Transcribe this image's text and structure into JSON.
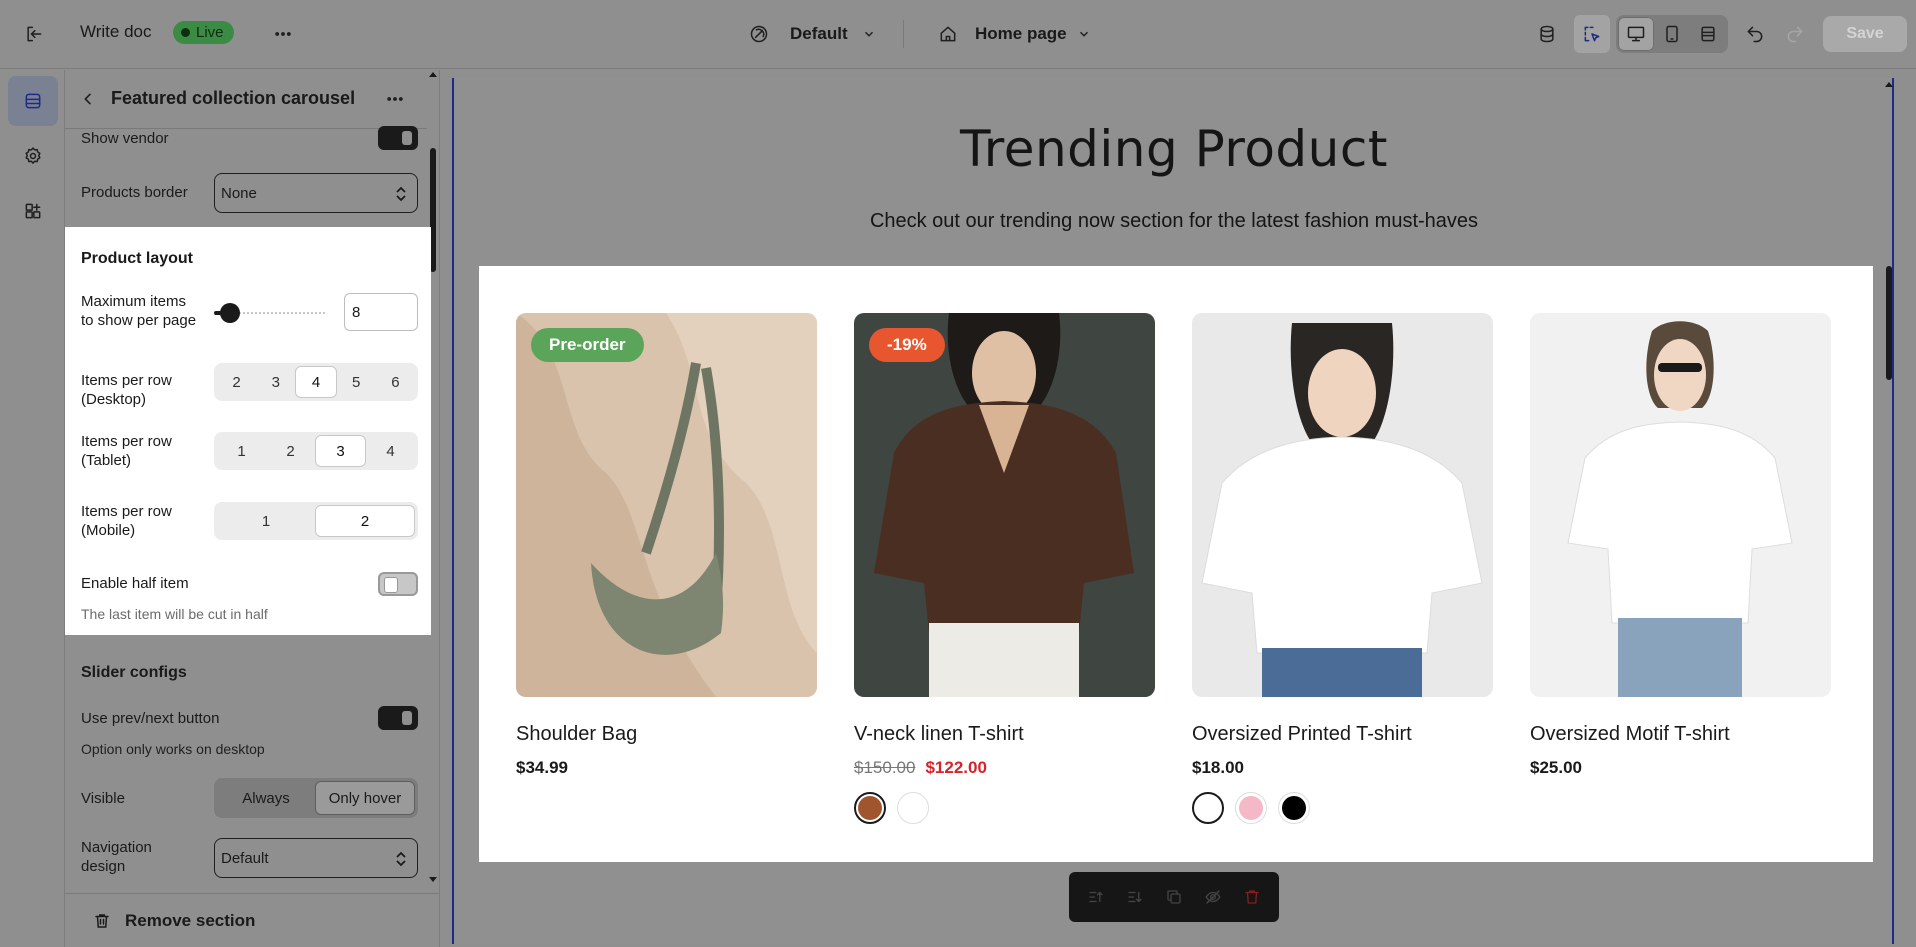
{
  "topbar": {
    "doc_title": "Write doc",
    "status": "Live",
    "theme_label": "Default",
    "page_label": "Home page",
    "save_label": "Save"
  },
  "panel": {
    "title": "Featured collection carousel",
    "show_vendor_label": "Show vendor",
    "products_border_label": "Products border",
    "products_border_value": "None",
    "product_layout_title": "Product layout",
    "max_items_label_1": "Maximum items",
    "max_items_label_2": "to show per page",
    "max_items_value": "8",
    "max_items_slider_fraction": 0.14,
    "desktop_label_1": "Items per row",
    "desktop_label_2": "(Desktop)",
    "desktop_options": [
      "2",
      "3",
      "4",
      "5",
      "6"
    ],
    "desktop_selected": "4",
    "tablet_label_1": "Items per row",
    "tablet_label_2": "(Tablet)",
    "tablet_options": [
      "1",
      "2",
      "3",
      "4"
    ],
    "tablet_selected": "3",
    "mobile_label_1": "Items per row",
    "mobile_label_2": "(Mobile)",
    "mobile_options": [
      "1",
      "2"
    ],
    "mobile_selected": "2",
    "half_item_label": "Enable half item",
    "half_item_hint": "The last item will be cut in half",
    "slider_configs_title": "Slider configs",
    "prev_next_label": "Use prev/next button",
    "prev_next_hint": "Option only works on desktop",
    "visible_label": "Visible",
    "visible_options": [
      "Always",
      "Only hover"
    ],
    "visible_selected": "Only hover",
    "nav_design_label_1": "Navigation",
    "nav_design_label_2": "design",
    "nav_design_value": "Default",
    "remove_label": "Remove section"
  },
  "canvas": {
    "heading": "Trending Product",
    "subheading": "Check out our trending now section for the latest fashion must-haves",
    "products": [
      {
        "name": "Shoulder Bag",
        "price": "$34.99",
        "badge": "Pre-order",
        "badge_color": "#5aa55a"
      },
      {
        "name": "V-neck linen T-shirt",
        "old_price": "$150.00",
        "price": "$122.00",
        "badge": "-19%",
        "badge_color": "#e8562f",
        "swatches": [
          "#a0552f",
          "#ffffff"
        ]
      },
      {
        "name": "Oversized Printed T-shirt",
        "price": "$18.00",
        "swatches": [
          "#ffffff",
          "#f4b8c6",
          "#000000"
        ]
      },
      {
        "name": "Oversized Motif T-shirt",
        "price": "$25.00"
      }
    ]
  }
}
